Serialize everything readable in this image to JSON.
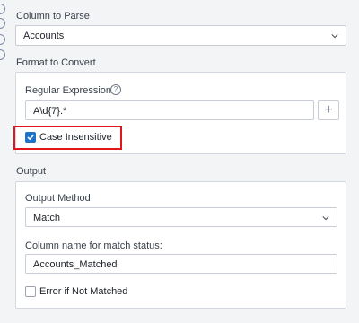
{
  "column_to_parse": {
    "label": "Column to Parse",
    "selected": "Accounts"
  },
  "format_to_convert": {
    "label": "Format to Convert",
    "regex_label": "Regular Expression",
    "help_icon": "?",
    "regex_value": "A\\d{7}.*",
    "case_insensitive_label": "Case Insensitive",
    "case_insensitive_checked": true,
    "add_button_symbol": "+"
  },
  "output": {
    "label": "Output",
    "method_label": "Output Method",
    "method_selected": "Match",
    "match_status_label": "Column name for match status:",
    "match_status_value": "Accounts_Matched",
    "error_label": "Error if Not Matched",
    "error_checked": false
  },
  "colors": {
    "accent": "#1f73c7",
    "highlight": "#e0161b"
  }
}
